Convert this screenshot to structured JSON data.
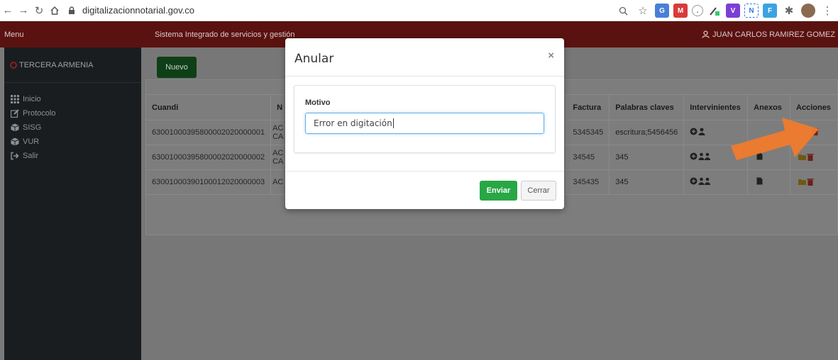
{
  "browser": {
    "url": "digitalizacionnotarial.gov.co"
  },
  "topbar": {
    "menu_label": "Menu",
    "system_title": "Sistema Integrado de servicios y gestión",
    "user_name": "JUAN CARLOS RAMIREZ GOMEZ"
  },
  "sidebar": {
    "notaria": "TERCERA ARMENIA",
    "items": [
      {
        "label": "Inicio",
        "icon": "grid-icon"
      },
      {
        "label": "Protocolo",
        "icon": "edit-icon"
      },
      {
        "label": "SISG",
        "icon": "cube-icon"
      },
      {
        "label": "VUR",
        "icon": "cube-icon"
      },
      {
        "label": "Salir",
        "icon": "sign-out-icon"
      }
    ]
  },
  "main": {
    "new_button": "Nuevo",
    "table": {
      "headers": [
        "Cuandi",
        "N",
        "Factura",
        "Palabras claves",
        "Intervinientes",
        "Anexos",
        "Acciones"
      ],
      "rows": [
        {
          "cuandi": "63001000395800002020000001",
          "n": "AC\nCA",
          "factura": "5345345",
          "palabras": "escritura;5456456"
        },
        {
          "cuandi": "63001000395800002020000002",
          "n": "AC\nCA",
          "factura": "34545",
          "palabras": "345"
        },
        {
          "cuandi": "63001000390100012020000003",
          "n": "AC",
          "factura": "345435",
          "palabras": "345"
        }
      ]
    }
  },
  "modal": {
    "title": "Anular",
    "close_symbol": "×",
    "field_label": "Motivo",
    "field_value": "Error en digitación",
    "submit_label": "Enviar",
    "cancel_label": "Cerrar"
  },
  "colors": {
    "header": "#8b1a17",
    "success": "#28a745",
    "arrow": "#f07b2c",
    "delete": "#c0392b",
    "folder": "#f0c419"
  }
}
